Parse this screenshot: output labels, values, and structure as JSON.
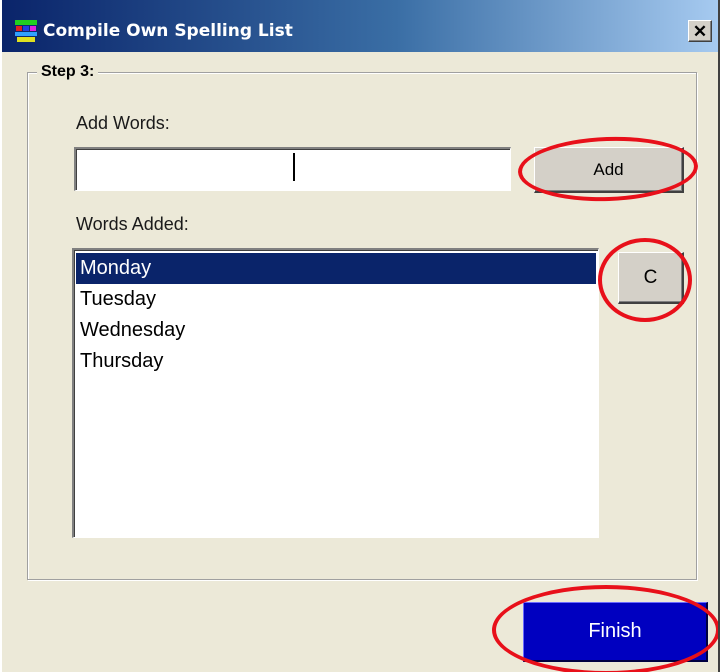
{
  "window": {
    "title": "Compile Own Spelling List",
    "close_glyph": "✕"
  },
  "group": {
    "legend": "Step 3:"
  },
  "add_section": {
    "label": "Add Words:",
    "input_value": "",
    "add_button_label": "Add"
  },
  "words_section": {
    "label": "Words Added:",
    "items": [
      "Monday",
      "Tuesday",
      "Wednesday",
      "Thursday"
    ],
    "selected_index": 0,
    "clear_button_label": "C"
  },
  "footer": {
    "finish_button_label": "Finish"
  },
  "icons": {
    "app_icon": "spelling-list-app-icon",
    "close_icon": "close-icon"
  },
  "colors": {
    "selection": "#0a246a",
    "finish_button": "#0000c0",
    "annotation": "#e8101a"
  }
}
